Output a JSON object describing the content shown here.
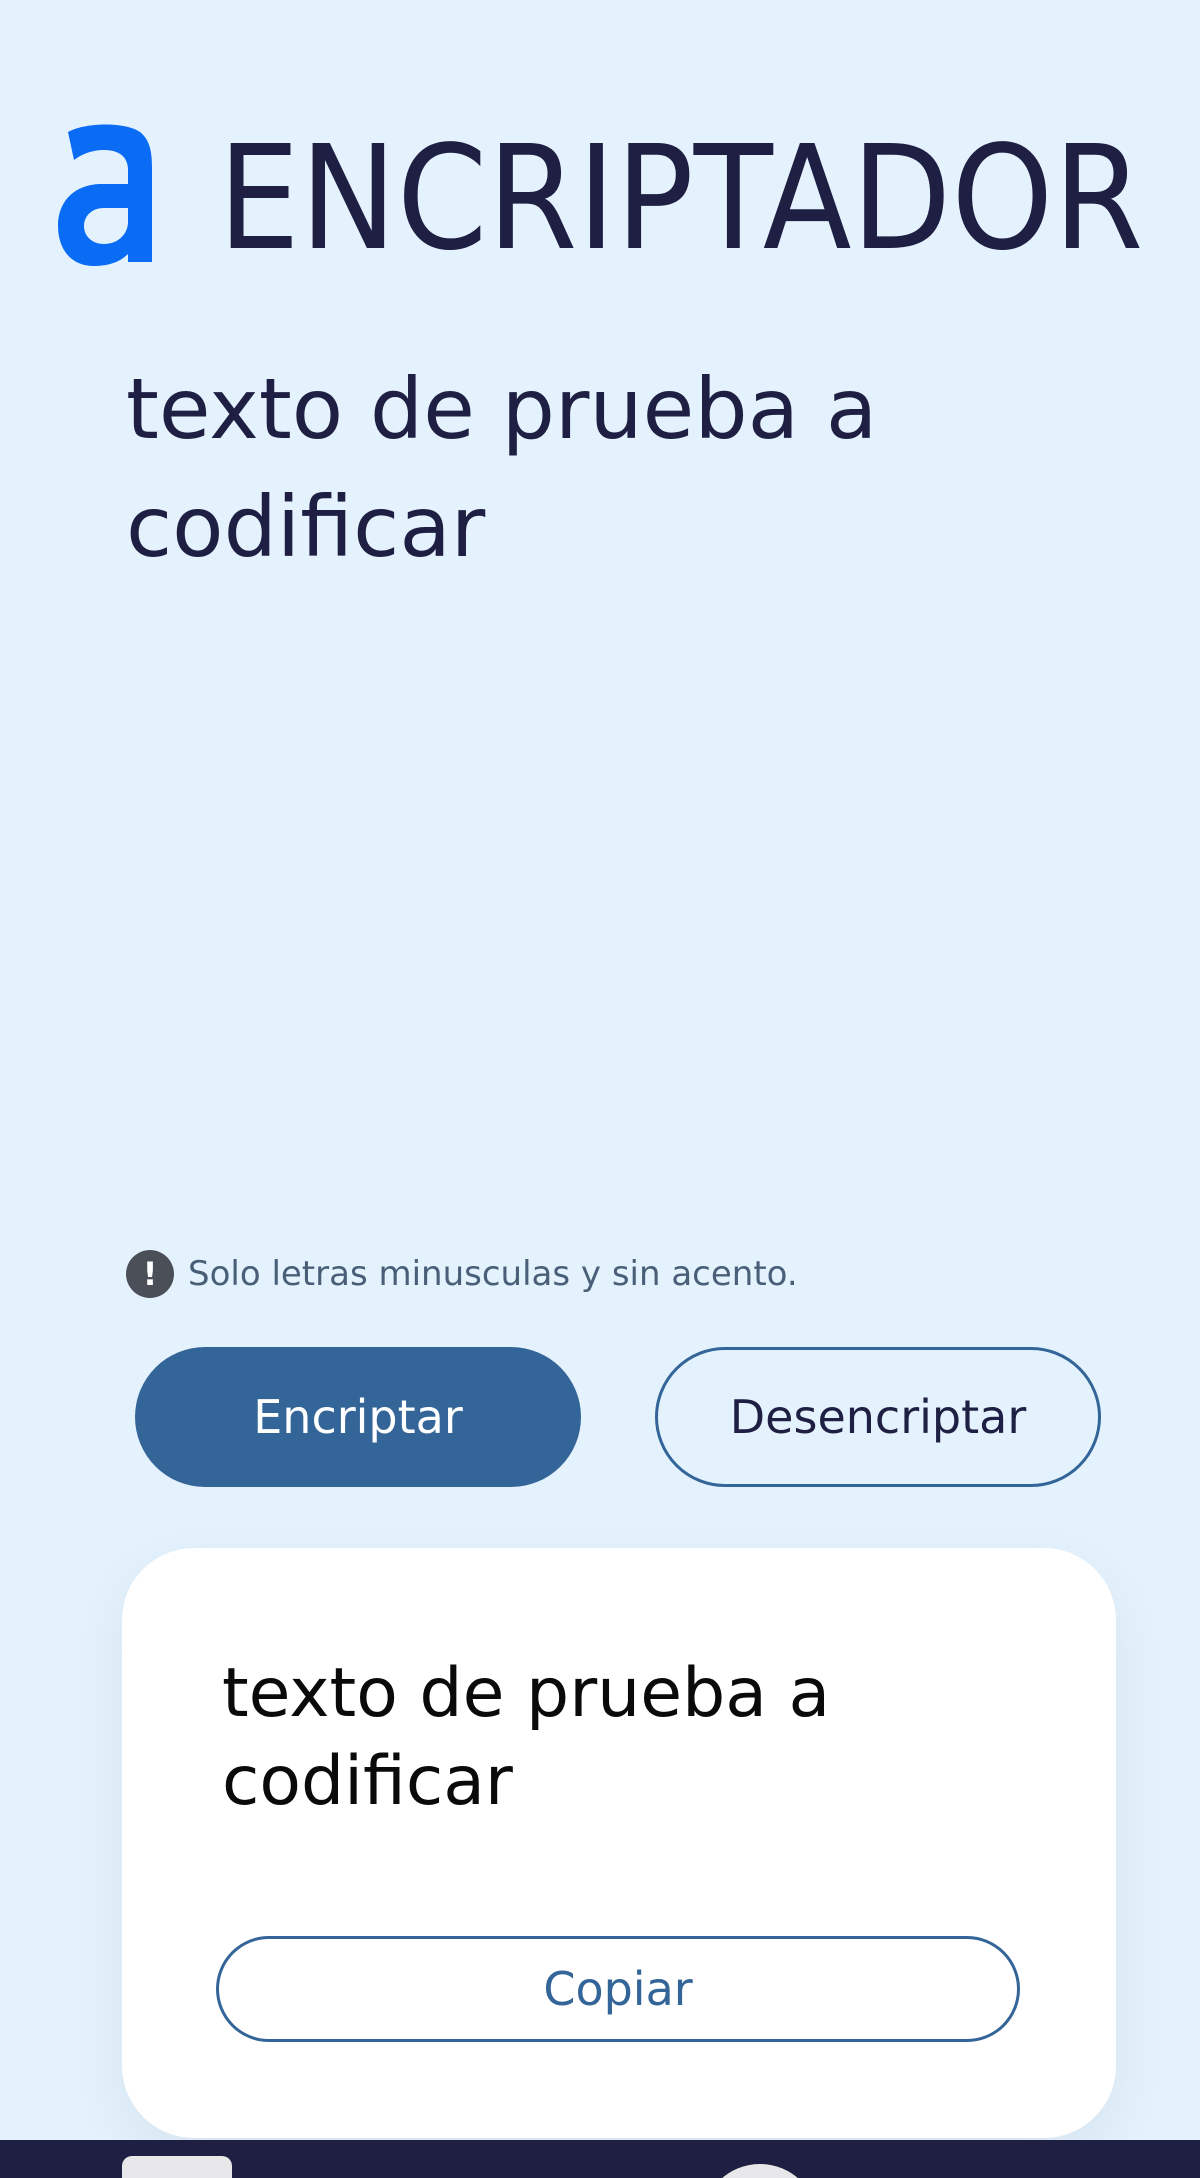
{
  "header": {
    "brand_name": "ENCRIPTADOR",
    "logo_icon": "alura-a-logo-icon",
    "logo_color": "#0a6cf5"
  },
  "input": {
    "value": "texto de prueba a codificar"
  },
  "hint": {
    "icon": "exclamation-circle-icon",
    "text": "Solo letras minusculas y sin acento."
  },
  "actions": {
    "encrypt_label": "Encriptar",
    "decrypt_label": "Desencriptar"
  },
  "result": {
    "text": "texto de prueba a codificar",
    "copy_label": "Copiar"
  },
  "colors": {
    "background": "#e4f2fd",
    "primary": "#336598",
    "dark_text": "#1e1f42",
    "card": "#ffffff"
  }
}
